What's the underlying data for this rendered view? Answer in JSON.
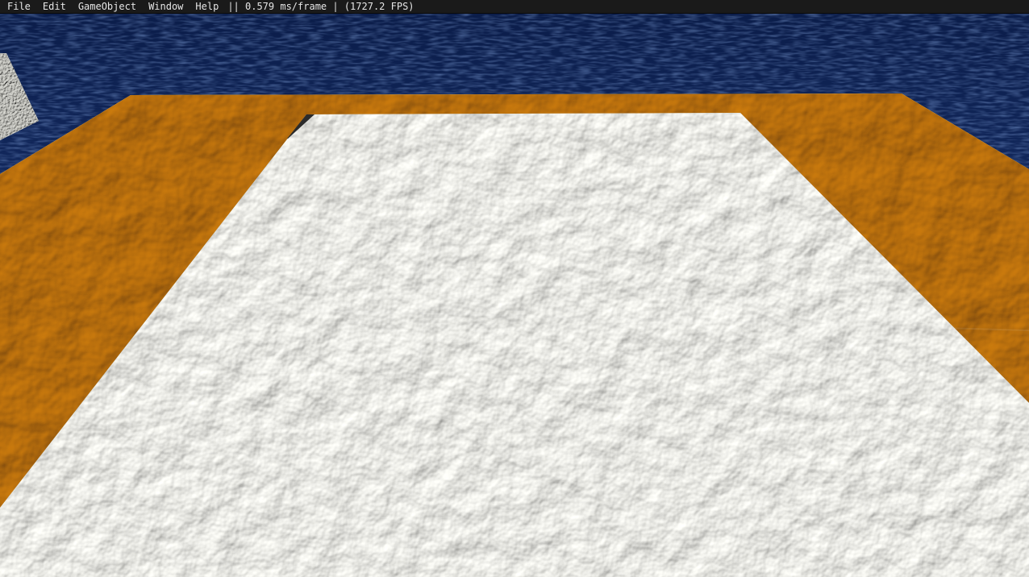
{
  "menubar": {
    "items": [
      "File",
      "Edit",
      "GameObject",
      "Window",
      "Help"
    ],
    "stats": "|| 0.579 ms/frame | (1727.2 FPS)"
  },
  "scene": {
    "objects": [
      "water-plane",
      "gold-plane",
      "silver-plane",
      "stone-cube"
    ],
    "colors": {
      "water_dark": "#0c1f4e",
      "water_mid": "#1f3a78",
      "gold_light": "#f2c259",
      "gold_dark": "#7a5a18",
      "silver_light": "#eeeeea",
      "silver_dark": "#6f706c"
    }
  }
}
